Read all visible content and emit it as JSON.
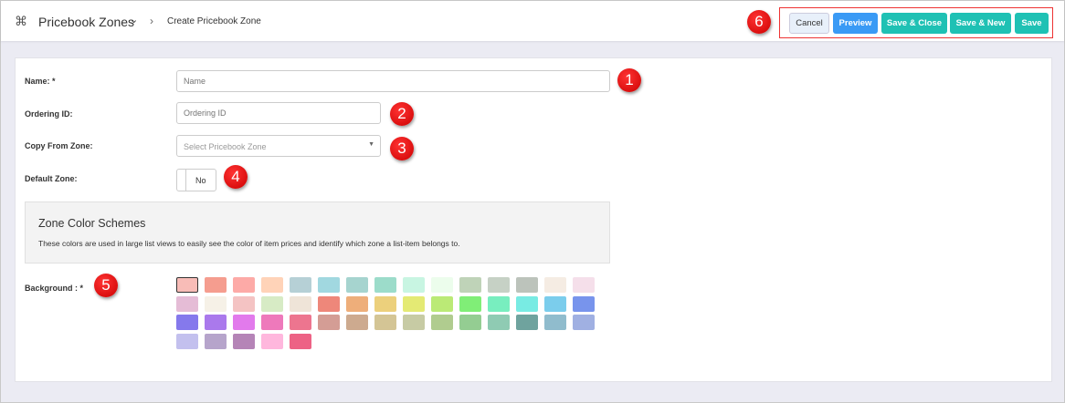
{
  "header": {
    "title": "Pricebook Zones",
    "breadcrumb": "Create Pricebook Zone",
    "icon": "command-icon"
  },
  "actions": {
    "cancel": "Cancel",
    "preview": "Preview",
    "save_close": "Save & Close",
    "save_new": "Save & New",
    "save": "Save"
  },
  "colors": {
    "cancel_bg": "#e8f0fa",
    "preview_bg": "#3a9af5",
    "save_bg": "#1fc1b4",
    "badge": "#dd1111"
  },
  "form": {
    "name": {
      "label": "Name: *",
      "placeholder": "Name"
    },
    "ordering": {
      "label": "Ordering ID:",
      "placeholder": "Ordering ID"
    },
    "copy": {
      "label": "Copy From Zone:",
      "placeholder": "Select Pricebook Zone"
    },
    "default": {
      "label": "Default Zone:",
      "value": "No"
    },
    "scheme": {
      "title": "Zone Color Schemes",
      "description": "These colors are used in large list views to easily see the color of item prices and identify which zone a list-item belongs to."
    },
    "background": {
      "label": "Background : *",
      "selected": 0
    }
  },
  "badges": [
    "1",
    "2",
    "3",
    "4",
    "5",
    "6"
  ],
  "swatches": [
    "#f8bcb7",
    "#f59d8f",
    "#fdaaa7",
    "#ffd3b8",
    "#b6d0d6",
    "#a1d8e0",
    "#a6d4cf",
    "#9cdcca",
    "#c8f5e2",
    "#ecfdec",
    "#bfd3b8",
    "#c6d1c5",
    "#bcc3bb",
    "#f5ece3",
    "#f5dfea",
    "#e5bcd6",
    "#f6f1e7",
    "#f4c3c3",
    "#d7ebc5",
    "#efe4d8",
    "#ee877a",
    "#eeae7a",
    "#ecd07c",
    "#e4ea74",
    "#bbea76",
    "#80ee77",
    "#78eebf",
    "#78ebe3",
    "#7bcdec",
    "#7894ec",
    "#8579ec",
    "#aa79ec",
    "#e27aec",
    "#ee79bb",
    "#ed758f",
    "#d49d95",
    "#cdaa8f",
    "#d4c595",
    "#c7cba4",
    "#b0cc8f",
    "#94cd92",
    "#8fcbb3",
    "#6fa39e",
    "#90bccd",
    "#a0b0e2",
    "#c3c0ee",
    "#b6a4cb",
    "#b584b7",
    "#ffb7dd",
    "#ed6285"
  ]
}
